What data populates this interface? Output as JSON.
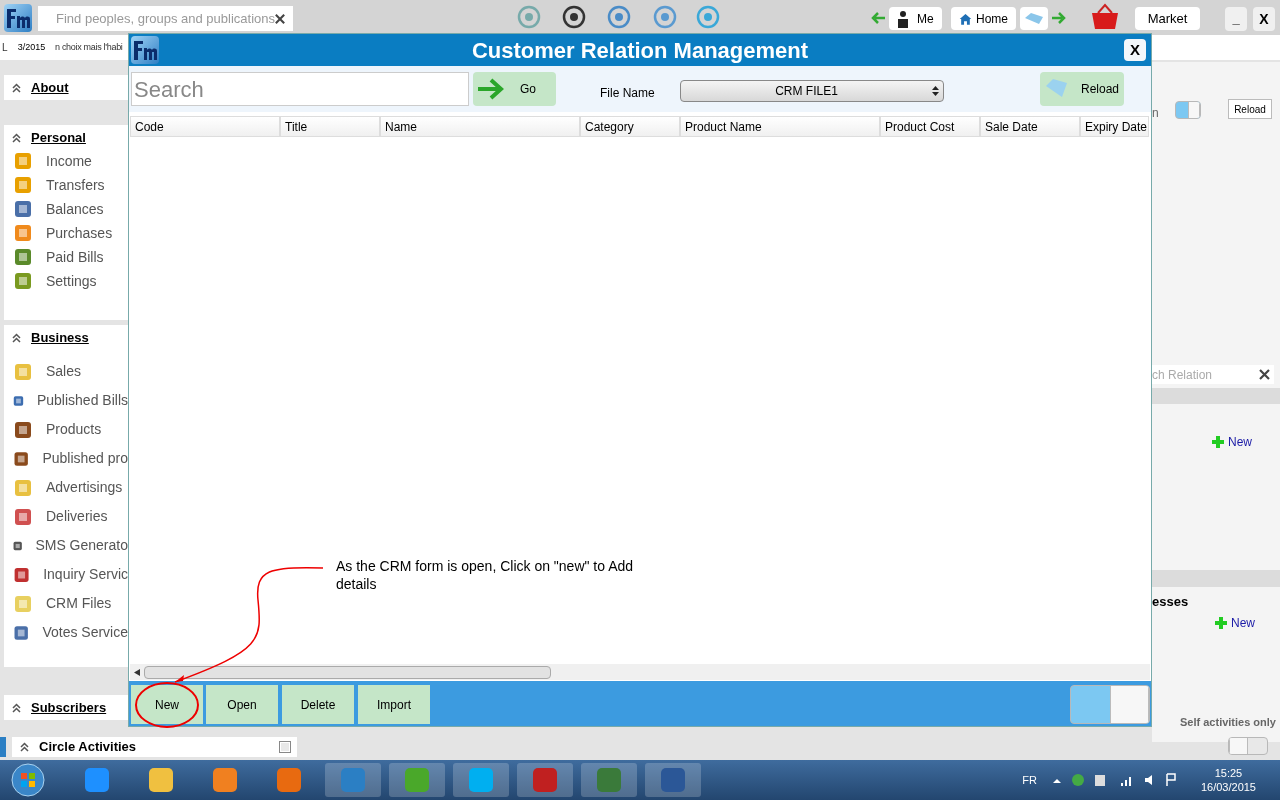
{
  "top_bar": {
    "search_placeholder": "Find peoples, groups and publications",
    "nav_buttons": [
      "Me",
      "Home"
    ],
    "market": "Market",
    "minimize": "_",
    "close": "X"
  },
  "background": {
    "date_badge": "3/2015",
    "snippet_start": "L",
    "snippet": "n choix mais l'habi",
    "right_label": "n",
    "right_toggle": {
      "on": true
    },
    "right_reload": "Reload",
    "relation_search_placeholder": "ch Relation",
    "new_links": [
      "New",
      "New"
    ],
    "section_fragment": "esses",
    "self_activities": "Self activities only",
    "self_toggle": {
      "on": false
    }
  },
  "sidebar": {
    "sections": [
      {
        "title": "About"
      },
      {
        "title": "Personal",
        "items": [
          "Income",
          "Transfers",
          "Balances",
          "Purchases",
          "Paid Bills",
          "Settings"
        ]
      },
      {
        "title": "Business",
        "items": [
          "Sales",
          "Published Bills",
          "Products",
          "Published pro",
          "Advertisings",
          "Deliveries",
          "SMS Generato",
          "Inquiry Servic",
          "CRM Files",
          "Votes Service"
        ]
      },
      {
        "title": "Subscribers"
      }
    ]
  },
  "circle_activities": {
    "title": "Circle Activities",
    "checked": false
  },
  "window": {
    "title": "Customer Relation Management",
    "close": "X",
    "search_placeholder": "Search",
    "go": "Go",
    "file_name_label": "File Name",
    "file_name": "CRM FILE1",
    "reload": "Reload",
    "table": {
      "columns": [
        "Code",
        "Title",
        "Name",
        "Category",
        "Product Name",
        "Product Cost",
        "Sale Date",
        "Expiry Date"
      ]
    },
    "buttons": [
      "New",
      "Open",
      "Delete",
      "Import"
    ],
    "toggle": {
      "on": true
    }
  },
  "annotation": {
    "text": "As the CRM form is open, Click on \"new\" to Add details"
  },
  "taskbar": {
    "language": "FR",
    "time": "15:25",
    "date": "16/03/2015"
  }
}
